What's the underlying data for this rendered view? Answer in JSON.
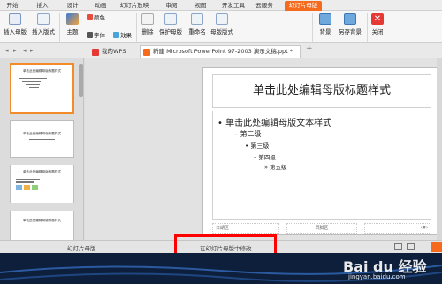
{
  "ribbon_tabs": [
    "开始",
    "插入",
    "设计",
    "动画",
    "幻灯片放映",
    "审阅",
    "视图",
    "开发工具",
    "云服务",
    "幻灯片母版"
  ],
  "ribbon": {
    "insert_master": "插入母版",
    "insert_layout": "插入版式",
    "theme": "主题",
    "font": "字体",
    "color": "颜色",
    "effect": "效果",
    "delete": "删除",
    "protect_master": "保护母版",
    "rename": "重命名",
    "master_layout": "母版版式",
    "background": "背景",
    "save_background": "另存背景",
    "close": "关闭"
  },
  "doc_tabs": {
    "my_wps": "我的WPS",
    "file": "新建 Microsoft PowerPoint 97-2003 演示文稿.ppt *",
    "add": "+"
  },
  "slide": {
    "title": "单击此处编辑母版标题样式",
    "levels": [
      "单击此处编辑母版文本样式",
      "第二级",
      "第三级",
      "第四级",
      "第五级"
    ],
    "footer": {
      "date": "日期区",
      "footer": "页脚区",
      "number": "‹#›"
    }
  },
  "thumbnails": [
    {
      "title": "单击此处编辑母版标题样式"
    },
    {
      "title": "单击此处编辑母版标题样式"
    },
    {
      "title": "单击此处编辑母版标题样式"
    },
    {
      "title": "单击此处编辑母版标题样式"
    }
  ],
  "status": {
    "left": "幻灯片母版",
    "center": "在幻灯片母版中修改"
  },
  "watermark": {
    "brand": "Bai du 经验",
    "url": "jingyan.baidu.com"
  },
  "colors": {
    "accent": "#f66a1e",
    "highlight": "#ff0000"
  }
}
